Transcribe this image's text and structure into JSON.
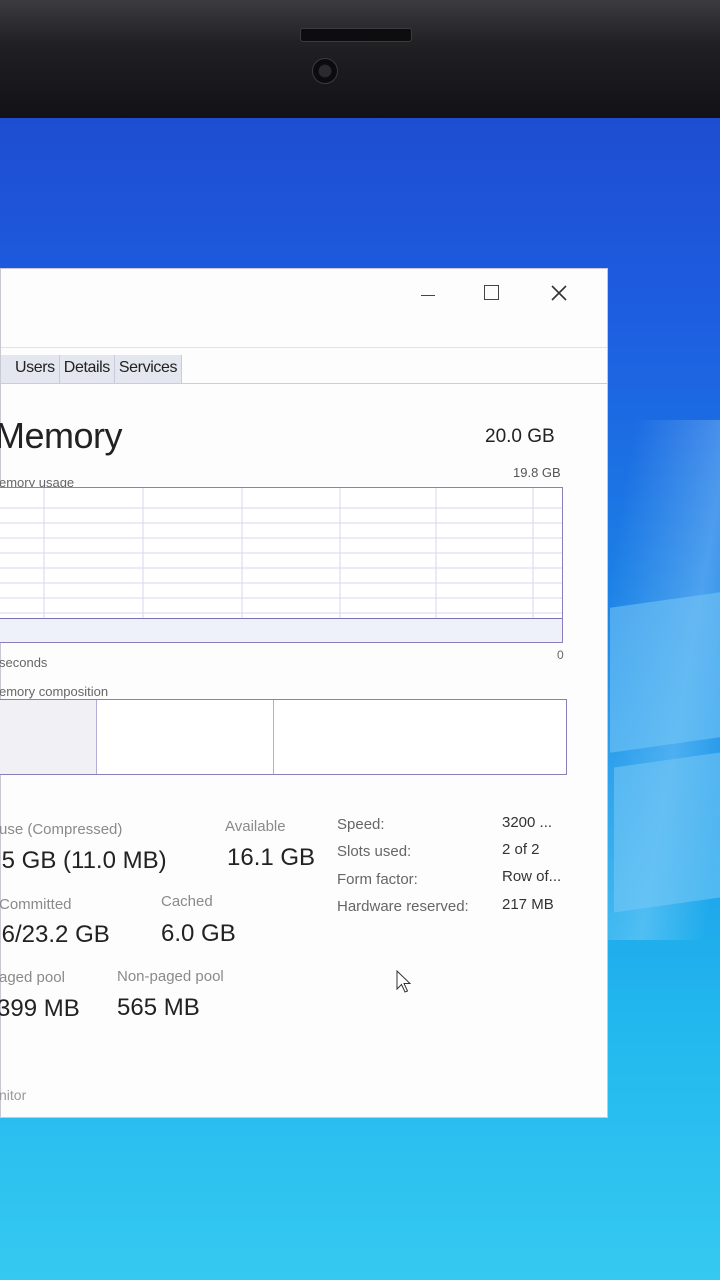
{
  "window": {
    "tabs": [
      "Users",
      "Details",
      "Services"
    ]
  },
  "memory": {
    "title": "Memory",
    "total": "20.0 GB",
    "usage_label": "emory usage",
    "max_value": "19.8 GB",
    "time_label": "seconds",
    "zero_label": "0",
    "composition_label": "emory composition",
    "usage_level_pct": 15
  },
  "stats": {
    "in_use_label": "use (Compressed)",
    "in_use_value": ".5 GB (11.0 MB)",
    "available_label": "Available",
    "available_value": "16.1 GB",
    "committed_label": "Committed",
    "committed_value": ".6/23.2 GB",
    "cached_label": "Cached",
    "cached_value": "6.0 GB",
    "paged_label": "aged pool",
    "paged_value": "399 MB",
    "nonpaged_label": "Non-paged pool",
    "nonpaged_value": "565 MB"
  },
  "specs": {
    "speed_label": "Speed:",
    "speed_value": "3200 ...",
    "slots_label": "Slots used:",
    "slots_value": "2 of 2",
    "form_label": "Form factor:",
    "form_value": "Row of...",
    "reserved_label": "Hardware reserved:",
    "reserved_value": "217 MB"
  },
  "footer": {
    "link": "nitor"
  }
}
